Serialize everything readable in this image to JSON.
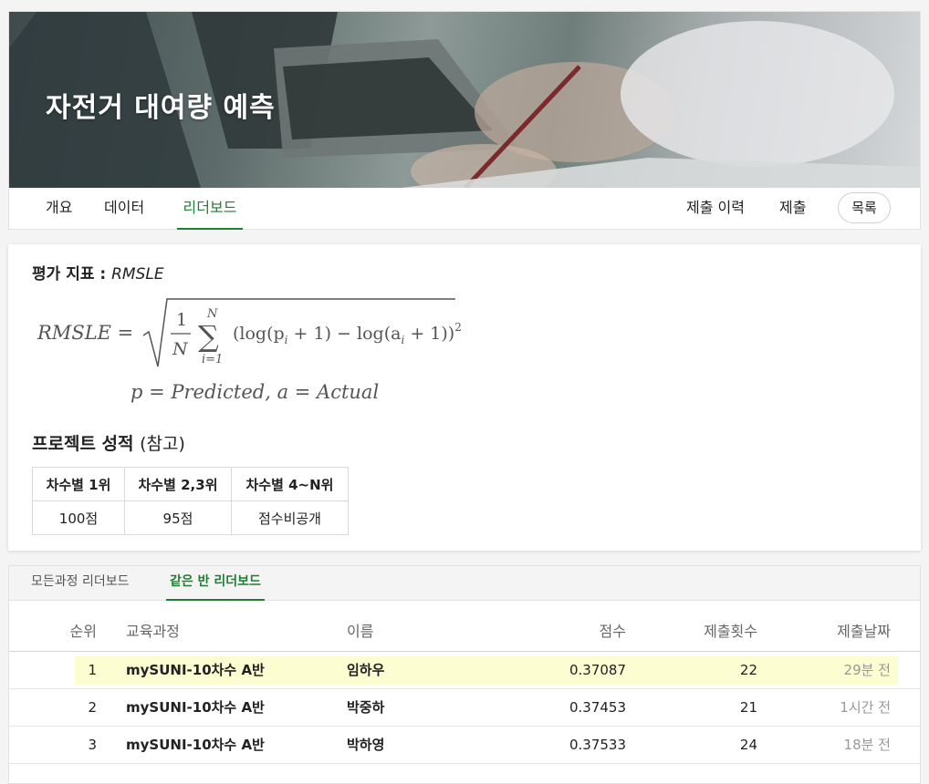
{
  "hero": {
    "title": "자전거 대여량 예측"
  },
  "nav": {
    "tabs": [
      {
        "label": "개요"
      },
      {
        "label": "데이터"
      },
      {
        "label": "리더보드"
      }
    ],
    "right": {
      "history": "제출 이력",
      "submit": "제출",
      "list": "목록"
    }
  },
  "metric": {
    "heading_prefix": "평가 지표 : ",
    "heading_name": "RMSLE",
    "formula_lhs": "RMSLE =",
    "formula_frac_num": "1",
    "formula_frac_den": "N",
    "formula_sum_top": "N",
    "formula_sum_bottom": "i=1",
    "formula_body": "(log(p",
    "formula_body_mid": " + 1) − log(a",
    "formula_body_end": " + 1))",
    "formula_sub_p": "i",
    "formula_sub_a": "i",
    "formula_exp": "2",
    "formula_legend": "p = Predicted, a = Actual"
  },
  "project_score": {
    "heading": "프로젝트 성적 ",
    "heading_paren": "(참고)",
    "headers": [
      "차수별 1위",
      "차수별 2,3위",
      "차수별 4~N위"
    ],
    "values": [
      "100점",
      "95점",
      "점수비공개"
    ]
  },
  "leaderboard": {
    "tabs": [
      {
        "label": "모든과정 리더보드"
      },
      {
        "label": "같은 반 리더보드"
      }
    ],
    "columns": {
      "rank": "순위",
      "course": "교육과정",
      "name": "이름",
      "score": "점수",
      "count": "제출횟수",
      "date": "제출날짜"
    },
    "rows": [
      {
        "rank": "1",
        "course": "mySUNI-10차수 A반",
        "name": "임하우",
        "score": "0.37087",
        "count": "22",
        "date": "29분 전"
      },
      {
        "rank": "2",
        "course": "mySUNI-10차수 A반",
        "name": "박중하",
        "score": "0.37453",
        "count": "21",
        "date": "1시간 전"
      },
      {
        "rank": "3",
        "course": "mySUNI-10차수 A반",
        "name": "박하영",
        "score": "0.37533",
        "count": "24",
        "date": "18분 전"
      }
    ]
  },
  "colors": {
    "accent": "#1e7e34",
    "highlight": "#fdfdd2"
  }
}
